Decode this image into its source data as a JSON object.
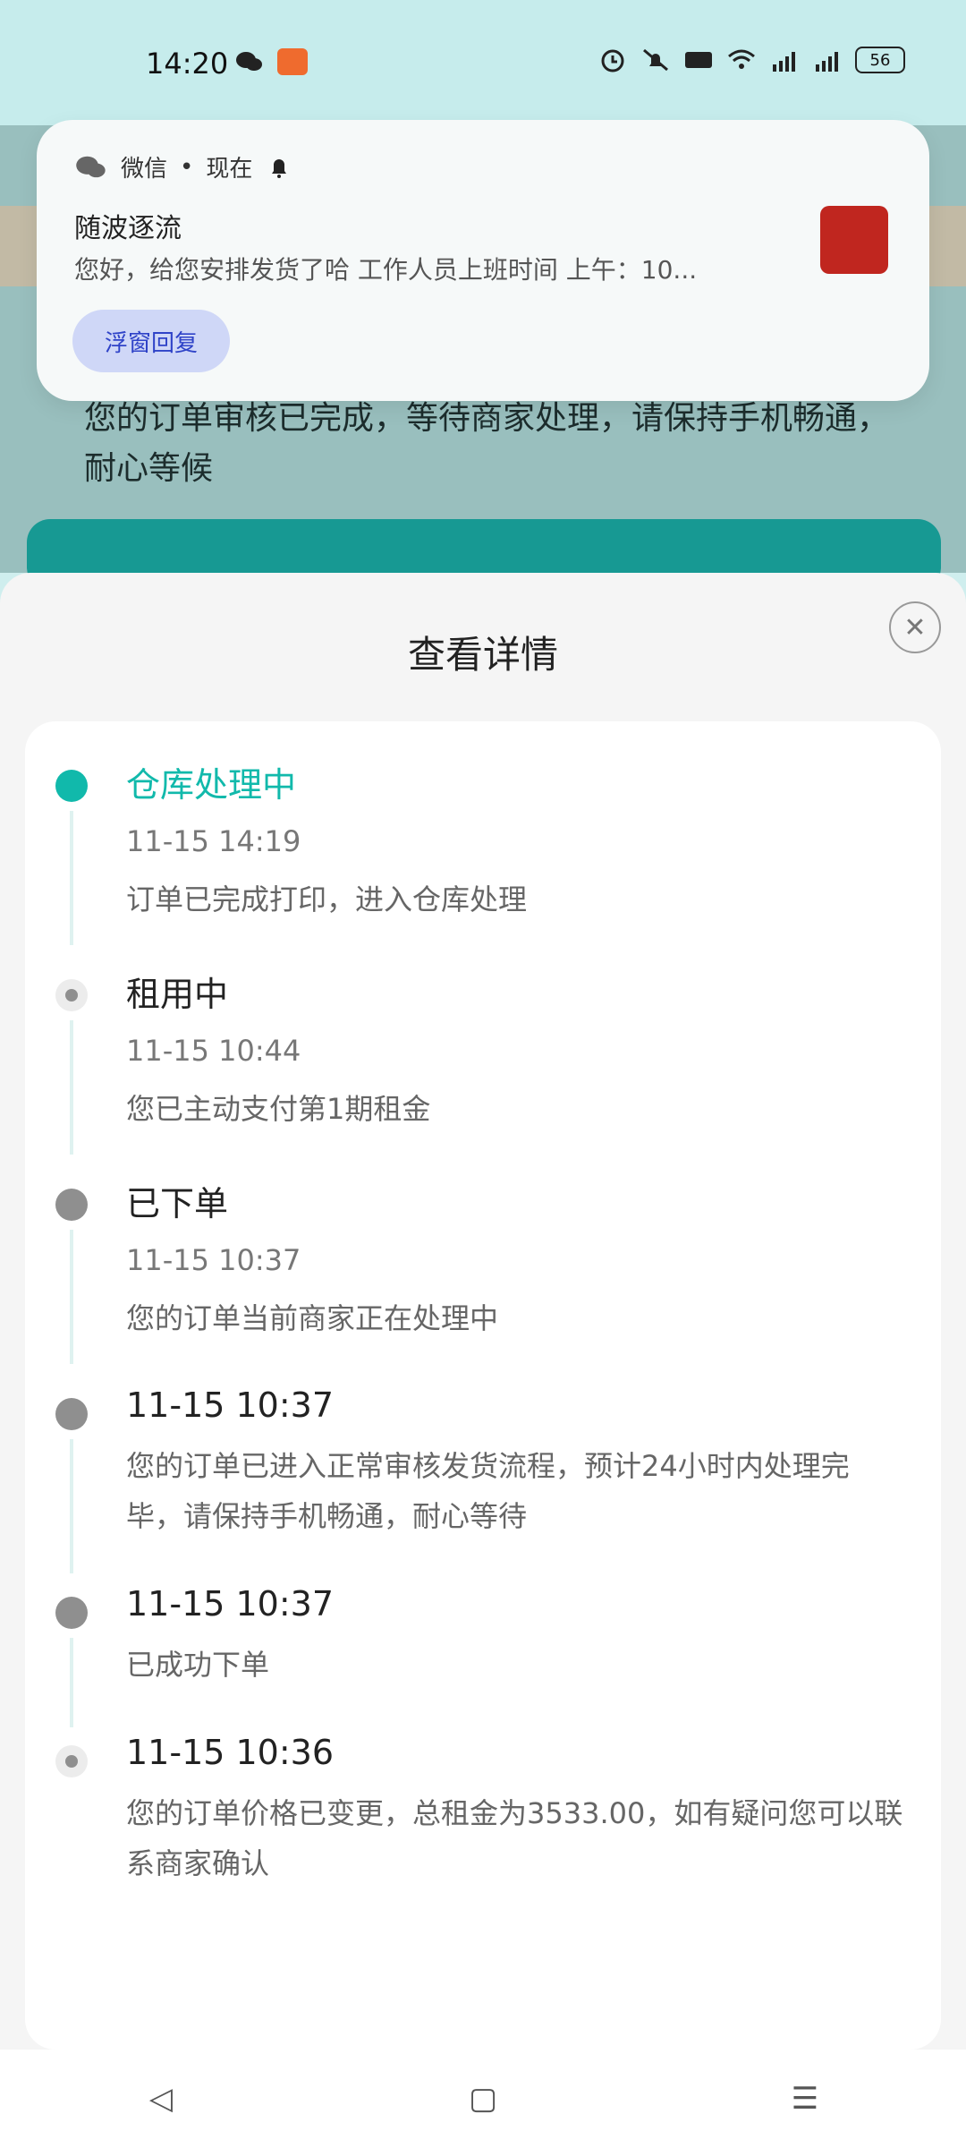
{
  "status_bar": {
    "time": "14:20",
    "battery": "56",
    "icons": [
      "wechat-icon",
      "app-icon",
      "alarm-icon",
      "mute-icon",
      "hd-icon",
      "wifi-icon",
      "signal-4g-icon",
      "signal-4g-icon"
    ]
  },
  "background": {
    "status_text": "您的订单审核已完成，等待商家处理，请保持手机畅通，耐心等候"
  },
  "notification": {
    "app": "微信",
    "time": "现在",
    "title": "随波逐流",
    "body": "您好，给您安排发货了哈 工作人员上班时间 上午：10...",
    "reply_label": "浮窗回复"
  },
  "sheet": {
    "title": "查看详情",
    "timeline": [
      {
        "heading": "仓库处理中",
        "time": "11-15 14:19",
        "desc": "订单已完成打印，进入仓库处理",
        "icon": "home-icon",
        "active": true
      },
      {
        "heading": "租用中",
        "time": "11-15 10:44",
        "desc": "您已主动支付第1期租金",
        "icon": "dot-icon"
      },
      {
        "heading": "已下单",
        "time": "11-15 10:37",
        "desc": "您的订单当前商家正在处理中",
        "icon": "document-icon"
      },
      {
        "heading": "11-15 10:37",
        "time": "",
        "desc": "您的订单已进入正常审核发货流程，预计24小时内处理完毕，请保持手机畅通，耐心等待",
        "icon": "document-icon"
      },
      {
        "heading": "11-15 10:37",
        "time": "",
        "desc": "已成功下单",
        "icon": "document-icon"
      },
      {
        "heading": "11-15 10:36",
        "time": "",
        "desc": "您的订单价格已变更，总租金为3533.00，如有疑问您可以联系商家确认",
        "icon": "dot-icon"
      }
    ]
  },
  "navbar": {
    "back": "◁",
    "home": "▢",
    "menu": "☰"
  },
  "colors": {
    "accent": "#11b9ab",
    "status_bg": "#c6ecec"
  }
}
